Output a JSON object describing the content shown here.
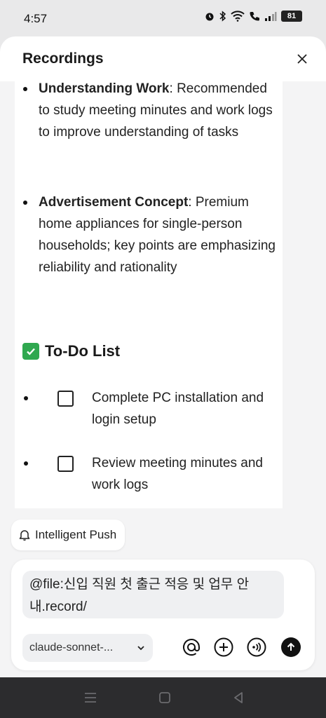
{
  "status_bar": {
    "time": "4:57",
    "battery": "81",
    "icons": [
      "alarm-icon",
      "bluetooth-icon",
      "wifi-icon",
      "call-icon",
      "signal-icon",
      "battery-icon"
    ]
  },
  "sheet": {
    "title": "Recordings"
  },
  "content": {
    "items": [
      {
        "label": "Understanding Work",
        "text": "Recommended to study meeting minutes and work logs to improve understanding of tasks"
      },
      {
        "label": "Advertisement Concept",
        "text": " Premium home appliances for single-person households; key points are emphasizing reliability and rationality"
      }
    ],
    "todo_heading": "To-Do List",
    "todos": [
      {
        "text": "Complete PC installation and login setup",
        "checked": false
      },
      {
        "text": "Review meeting minutes and work logs",
        "checked": false
      }
    ]
  },
  "push_chip": {
    "label": "Intelligent Push"
  },
  "composer": {
    "input_value": "@file:신입 직원 첫 출근 적응 및 업무 안내.record/",
    "model": "claude-sonnet-...",
    "tools": [
      "at-icon",
      "add-icon",
      "voice-icon",
      "send-icon"
    ]
  },
  "colors": {
    "accent_check": "#2fa84f",
    "send": "#111111"
  }
}
